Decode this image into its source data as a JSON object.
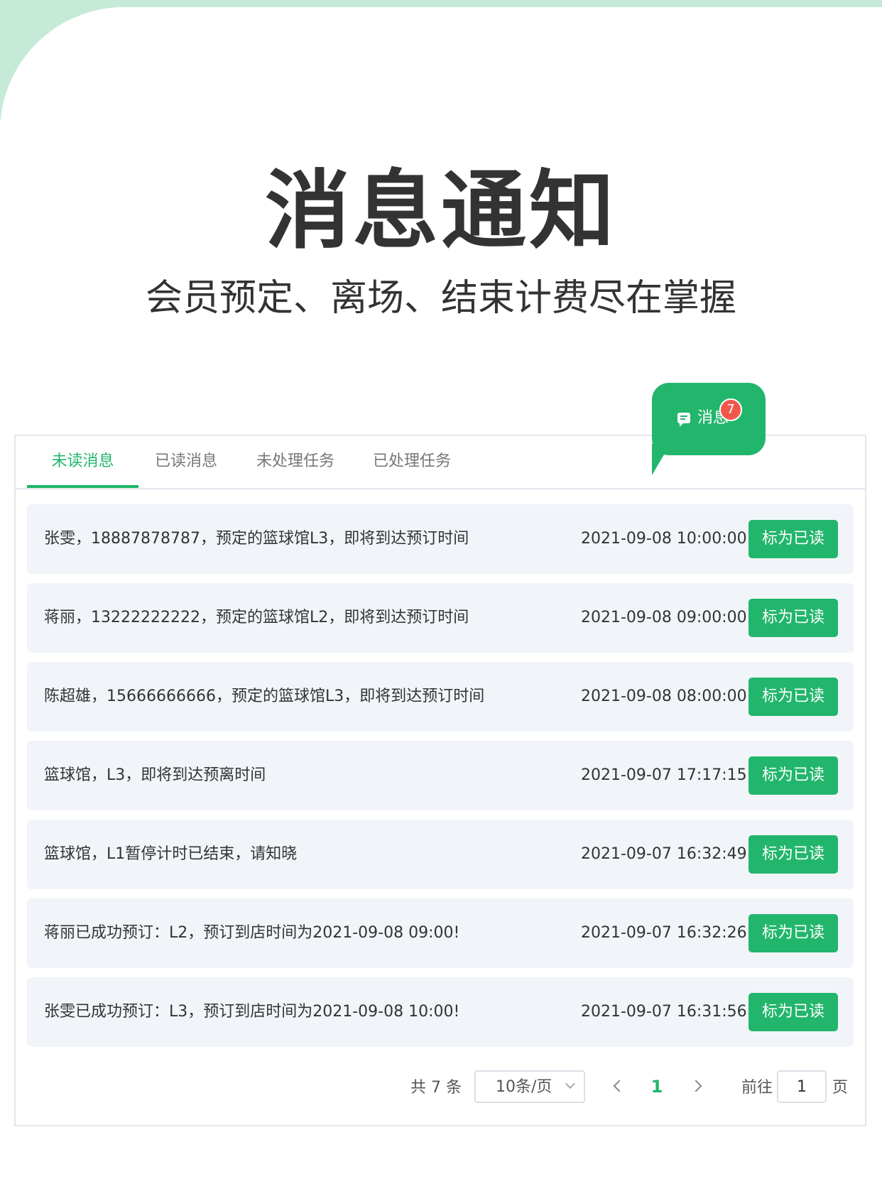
{
  "hero": {
    "title": "消息通知",
    "subtitle": "会员预定、离场、结束计费尽在掌握"
  },
  "notification_bubble": {
    "label": "消息",
    "badge_count": "7",
    "icon": "message-icon"
  },
  "tabs": [
    {
      "label": "未读消息",
      "active": true
    },
    {
      "label": "已读消息",
      "active": false
    },
    {
      "label": "未处理任务",
      "active": false
    },
    {
      "label": "已处理任务",
      "active": false
    }
  ],
  "messages": [
    {
      "text": "张雯，18887878787，预定的篮球馆L3，即将到达预订时间",
      "time": "2021-09-08 10:00:00",
      "action": "标为已读"
    },
    {
      "text": "蒋丽，13222222222，预定的篮球馆L2，即将到达预订时间",
      "time": "2021-09-08 09:00:00",
      "action": "标为已读"
    },
    {
      "text": "陈超雄，15666666666，预定的篮球馆L3，即将到达预订时间",
      "time": "2021-09-08 08:00:00",
      "action": "标为已读"
    },
    {
      "text": "篮球馆，L3，即将到达预离时间",
      "time": "2021-09-07 17:17:15",
      "action": "标为已读"
    },
    {
      "text": "篮球馆，L1暂停计时已结束，请知晓",
      "time": "2021-09-07 16:32:49",
      "action": "标为已读"
    },
    {
      "text": "蒋丽已成功预订：L2，预订到店时间为2021-09-08 09:00!",
      "time": "2021-09-07 16:32:26",
      "action": "标为已读"
    },
    {
      "text": "张雯已成功预订：L3，预订到店时间为2021-09-08 10:00!",
      "time": "2021-09-07 16:31:56",
      "action": "标为已读"
    }
  ],
  "pagination": {
    "total": "共 7 条",
    "page_size": "10条/页",
    "current_page": "1",
    "goto_label": "前往",
    "goto_value": "1",
    "page_suffix": "页"
  },
  "colors": {
    "accent": "#22b66c",
    "badge": "#f0574b",
    "row_bg": "#f1f5fa",
    "decor": "#c6ead8"
  }
}
